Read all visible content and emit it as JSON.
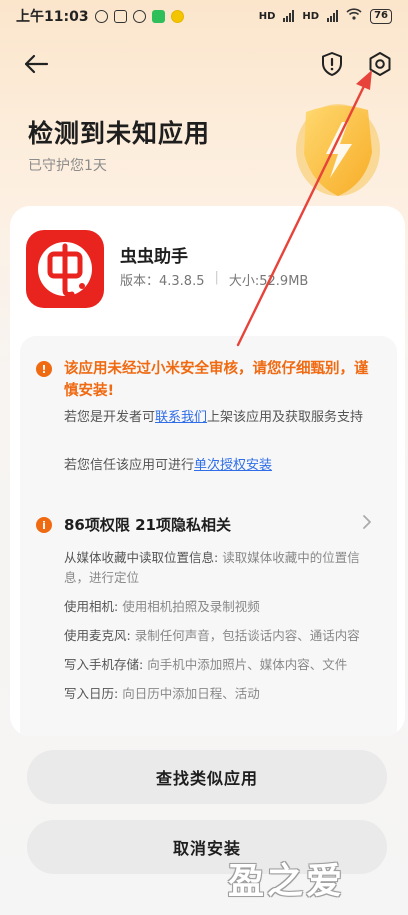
{
  "status_bar": {
    "time": "上午11:03",
    "network_1": "HD",
    "network_2": "HD",
    "battery": "76"
  },
  "header": {
    "title": "检测到未知应用",
    "subtitle": "已守护您1天"
  },
  "app": {
    "name": "虫虫助手",
    "version": "版本：4.3.8.5",
    "size": "大小:52.9MB"
  },
  "warning": {
    "title": "该应用未经过小米安全审核，请您仔细甄别，谨慎安装!",
    "dev_prefix": "若您是开发者可",
    "dev_link": "联系我们",
    "dev_suffix": "上架该应用及获取服务支持",
    "trust_prefix": "若您信任该应用可进行",
    "trust_link": "单次授权安装"
  },
  "permissions": {
    "heading": "86项权限 21项隐私相关",
    "items": [
      {
        "label": "从媒体收藏中读取位置信息:",
        "desc": " 读取媒体收藏中的位置信息，进行定位"
      },
      {
        "label": "使用相机:",
        "desc": " 使用相机拍照及录制视频"
      },
      {
        "label": "使用麦克风:",
        "desc": " 录制任何声音，包括谈话内容、通话内容"
      },
      {
        "label": "写入手机存储:",
        "desc": " 向手机中添加照片、媒体内容、文件"
      },
      {
        "label": "写入日历:",
        "desc": " 向日历中添加日程、活动"
      }
    ]
  },
  "buttons": {
    "find_similar": "查找类似应用",
    "cancel_install": "取消安装"
  },
  "watermark": "盈之爱",
  "colors": {
    "warning": "#f06a12",
    "link": "#2f6ee8",
    "app_icon": "#e9231d",
    "annotation_arrow": "#e8433a"
  }
}
